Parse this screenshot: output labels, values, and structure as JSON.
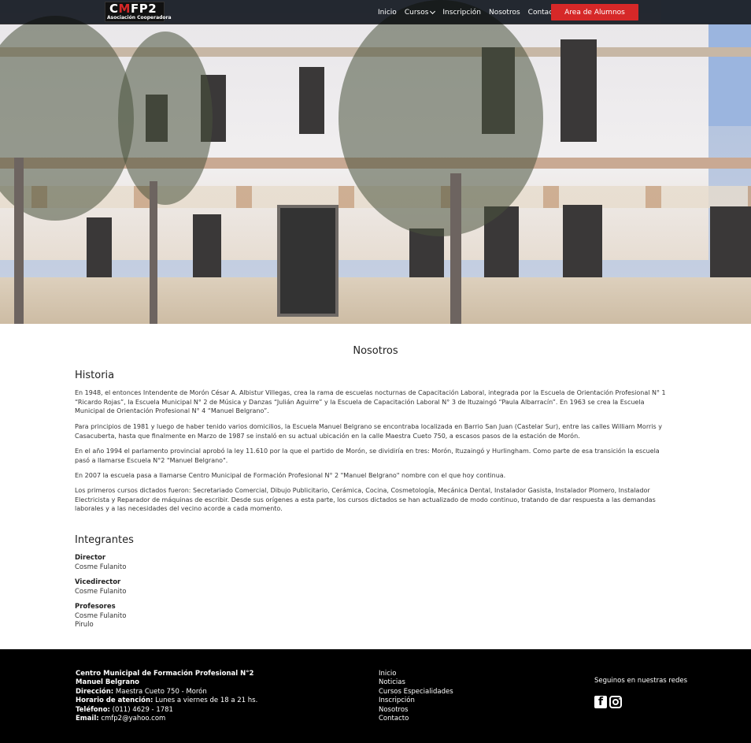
{
  "brand": {
    "logo_text_a": "C",
    "logo_text_m": "M",
    "logo_text_b": "FP2",
    "logo_subtitle": "Asociación Cooperadora",
    "accent": "#d62828"
  },
  "nav": {
    "items": [
      "Inicio",
      "Cursos",
      "Inscripción",
      "Nosotros",
      "Contacto"
    ],
    "cta": "Area de Alumnos"
  },
  "page": {
    "title": "Nosotros",
    "historia_heading": "Historia",
    "paragraphs": [
      "En 1948, el entonces Intendente de Morón César A. Albistur Villegas, crea la rama de escuelas nocturnas de Capacitación Laboral, integrada por la Escuela de Orientación Profesional N° 1 “Ricardo Rojas”, la Escuela Municipal N° 2 de Música y Danzas “Julián Aguirre” y la Escuela de Capacitación Laboral N° 3 de Ituzaingó “Paula Albarracín”. En 1963 se crea la Escuela Municipal de Orientación Profesional N° 4 “Manuel Belgrano”.",
      "Para principios de 1981 y luego de haber tenido varios domicilios, la Escuela Manuel Belgrano se encontraba localizada en Barrio San Juan (Castelar Sur), entre las calles William Morris y Casacuberta, hasta que finalmente en Marzo de 1987 se instaló en su actual ubicación en la calle Maestra Cueto 750, a escasos pasos de la estación de Morón.",
      "En el año 1994 el parlamento provincial aprobó la ley 11.610 por la que el partido de Morón, se dividiría en tres: Morón, Ituzaingó y Hurlingham. Como parte de esa transición la escuela pasó a llamarse Escuela N°2 \"Manuel Belgrano\".",
      "En 2007 la escuela pasa a llamarse Centro Municipal de Formación Profesional N° 2 \"Manuel Belgrano\" nombre con el que hoy continua.",
      "Los primeros cursos dictados fueron: Secretariado Comercial, Dibujo Publicitario, Cerámica, Cocina, Cosmetología, Mecánica Dental, Instalador Gasista, Instalador Plomero, Instalador Electricista y Reparador de máquinas de escribir. Desde sus orígenes a esta parte, los cursos dictados se han actualizado de modo continuo, tratando de dar respuesta a las demandas laborales y a las necesidades del vecino acorde a cada momento."
    ],
    "integrantes_heading": "Integrantes",
    "roles": [
      {
        "role": "Director",
        "members": [
          "Cosme Fulanito"
        ]
      },
      {
        "role": "Vicedirector",
        "members": [
          "Cosme Fulanito"
        ]
      },
      {
        "role": "Profesores",
        "members": [
          "Cosme Fulanito",
          "Pirulo"
        ]
      }
    ]
  },
  "footer": {
    "name_line1": "Centro Municipal de Formación Profesional N°2",
    "name_line2": "Manuel Belgrano",
    "address_label": "Dirección:",
    "address": "Maestra Cueto 750 - Morón",
    "hours_label": "Horario de atención:",
    "hours": "Lunes a viernes de 18 a 21 hs.",
    "phone_label": "Teléfono:",
    "phone": "(011) 4629 - 1781",
    "email_label": "Email:",
    "email": "cmfp2@yahoo.com",
    "links": [
      "Inicio",
      "Noticias",
      "Cursos Especialidades",
      "Inscripción",
      "Nosotros",
      "Contacto"
    ],
    "social_title": "Seguinos en nuestras redes",
    "social_icons": [
      "facebook-icon",
      "instagram-icon"
    ]
  }
}
